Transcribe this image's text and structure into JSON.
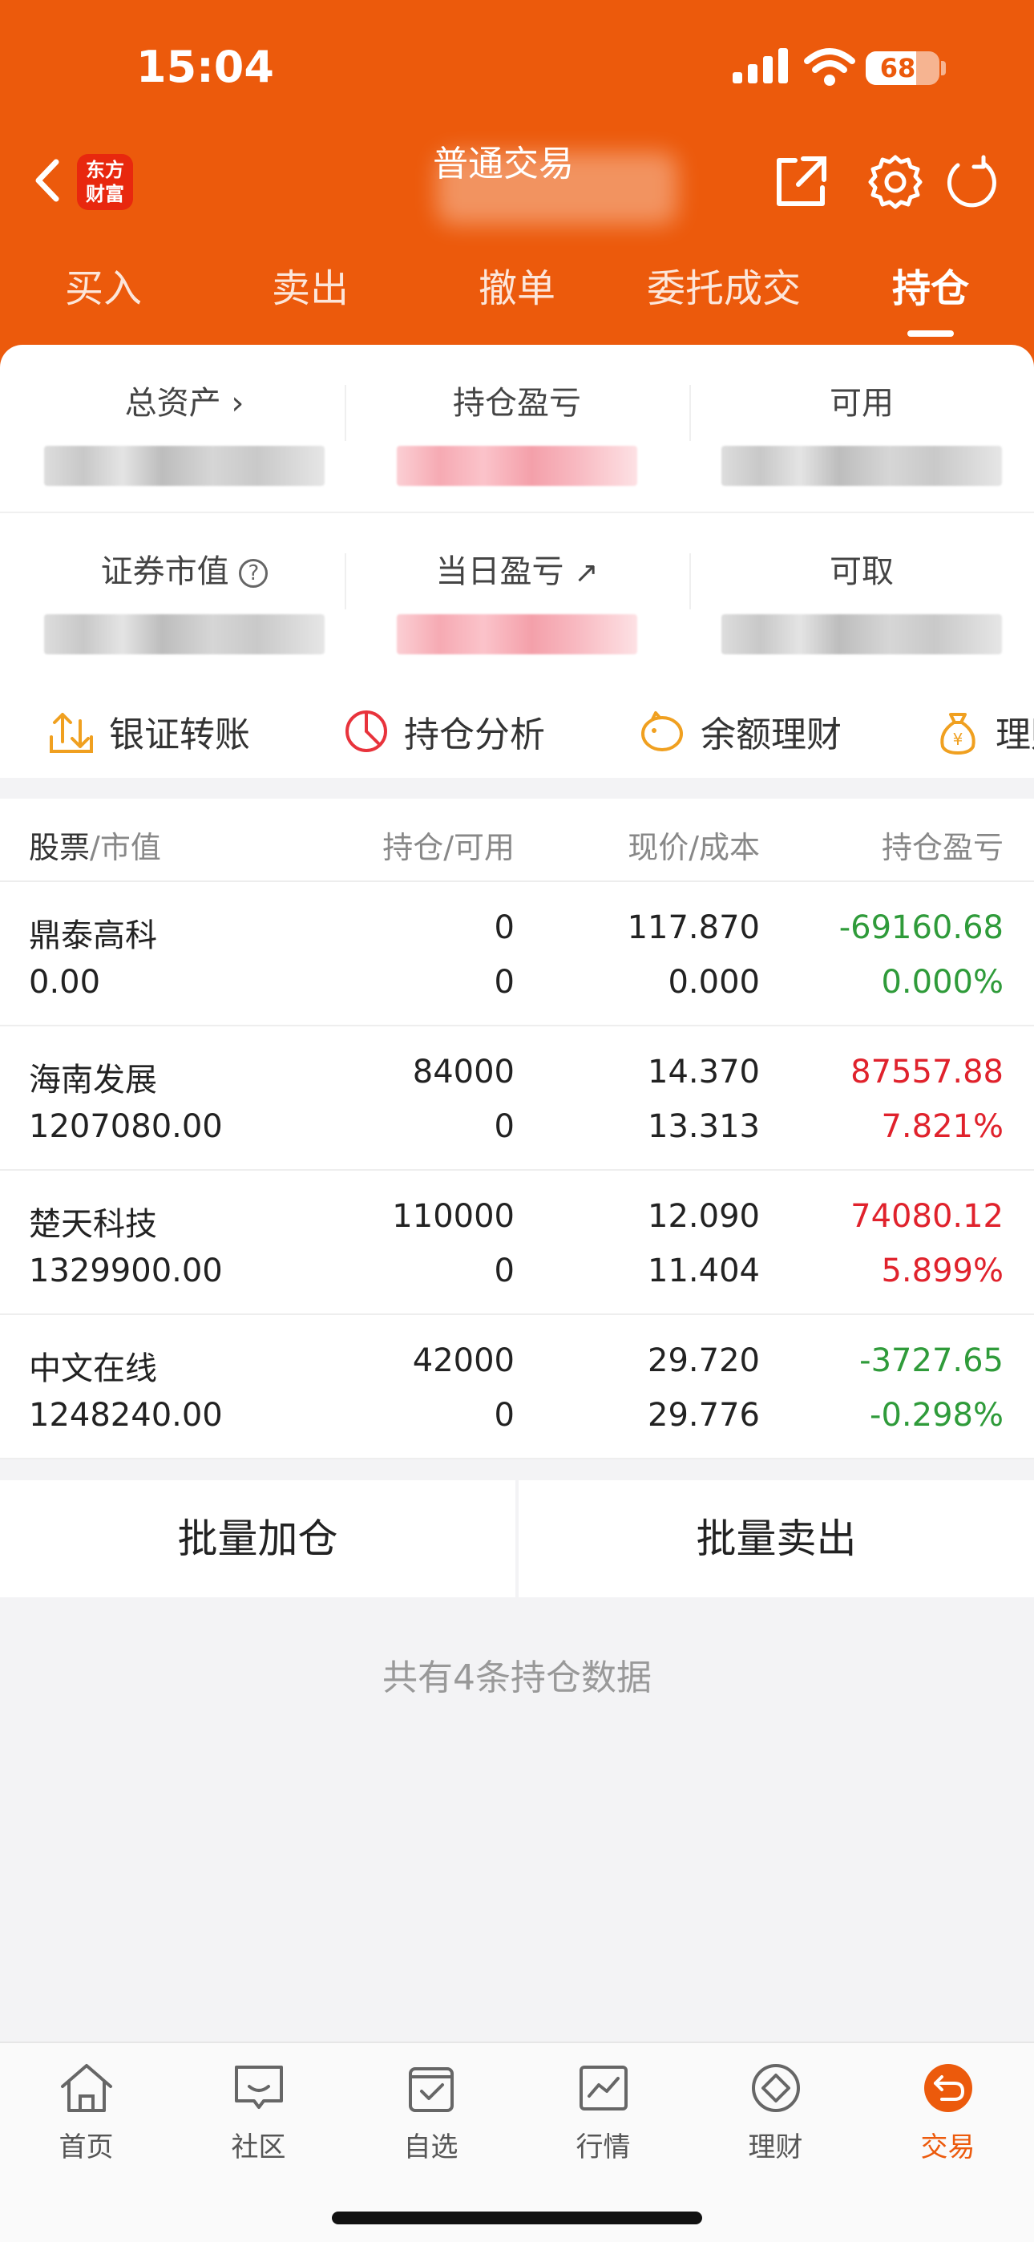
{
  "status": {
    "time": "15:04",
    "battery": "68"
  },
  "header": {
    "logo_line1": "东方",
    "logo_line2": "财富",
    "title": "普通交易"
  },
  "tabs": [
    "买入",
    "卖出",
    "撤单",
    "委托成交",
    "持仓"
  ],
  "active_tab": "持仓",
  "summary": {
    "total_assets": "总资产",
    "position_pl": "持仓盈亏",
    "available": "可用",
    "market_value": "证券市值",
    "daily_pl": "当日盈亏",
    "withdrawable": "可取"
  },
  "actions": [
    "银证转账",
    "持仓分析",
    "余额理财",
    "理财"
  ],
  "table": {
    "headers": {
      "stock": "股票",
      "market_value": "/市值",
      "position": "持仓/可用",
      "price": "现价/成本",
      "pl": "持仓盈亏"
    },
    "rows": [
      {
        "name": "鼎泰高科",
        "value": "0.00",
        "position": "0",
        "available": "0",
        "price": "117.870",
        "cost": "0.000",
        "pl": "-69160.68",
        "pl_pct": "0.000%",
        "trend": "down"
      },
      {
        "name": "海南发展",
        "value": "1207080.00",
        "position": "84000",
        "available": "0",
        "price": "14.370",
        "cost": "13.313",
        "pl": "87557.88",
        "pl_pct": "7.821%",
        "trend": "up"
      },
      {
        "name": "楚天科技",
        "value": "1329900.00",
        "position": "110000",
        "available": "0",
        "price": "12.090",
        "cost": "11.404",
        "pl": "74080.12",
        "pl_pct": "5.899%",
        "trend": "up"
      },
      {
        "name": "中文在线",
        "value": "1248240.00",
        "position": "42000",
        "available": "0",
        "price": "29.720",
        "cost": "29.776",
        "pl": "-3727.65",
        "pl_pct": "-0.298%",
        "trend": "down"
      }
    ]
  },
  "batch": {
    "add": "批量加仓",
    "sell": "批量卖出"
  },
  "footer_note": "共有4条持仓数据",
  "nav": [
    "首页",
    "社区",
    "自选",
    "行情",
    "理财",
    "交易"
  ],
  "colors": {
    "brand": "#ec5a0c",
    "up": "#e0222c",
    "down": "#2f9b3a"
  }
}
